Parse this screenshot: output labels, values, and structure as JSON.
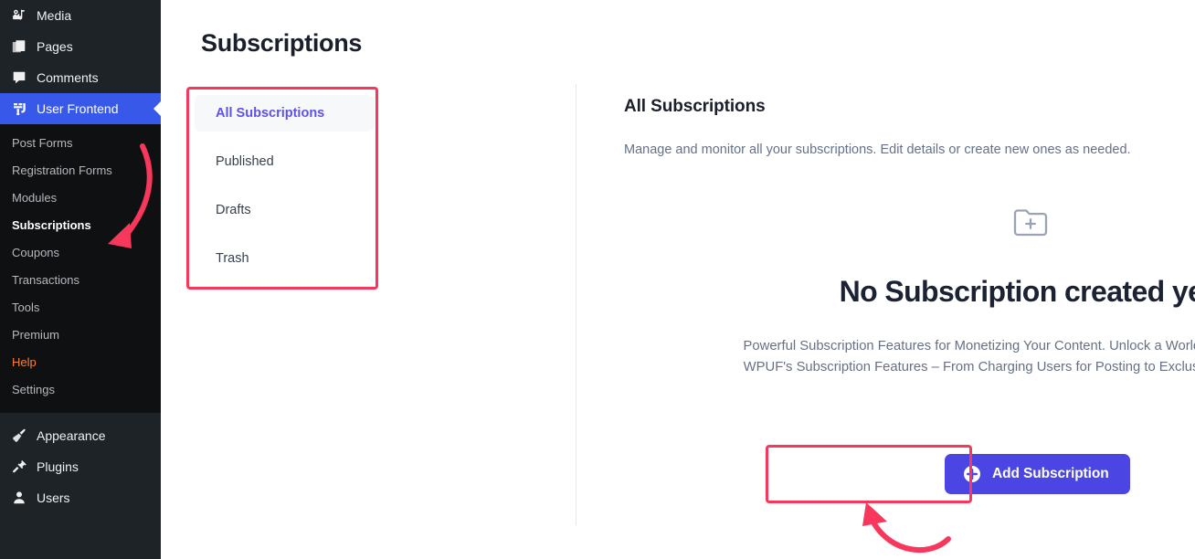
{
  "sidebar": {
    "top_items": [
      {
        "label": "Media",
        "icon": "media-icon"
      },
      {
        "label": "Pages",
        "icon": "pages-icon"
      },
      {
        "label": "Comments",
        "icon": "comments-icon"
      }
    ],
    "active_item": {
      "label": "User Frontend",
      "icon": "wpuf-logo-icon"
    },
    "submenu_items": [
      {
        "label": "Post Forms",
        "state": "normal"
      },
      {
        "label": "Registration Forms",
        "state": "normal"
      },
      {
        "label": "Modules",
        "state": "normal"
      },
      {
        "label": "Subscriptions",
        "state": "current"
      },
      {
        "label": "Coupons",
        "state": "normal"
      },
      {
        "label": "Transactions",
        "state": "normal"
      },
      {
        "label": "Tools",
        "state": "normal"
      },
      {
        "label": "Premium",
        "state": "normal"
      },
      {
        "label": "Help",
        "state": "help"
      },
      {
        "label": "Settings",
        "state": "normal"
      }
    ],
    "bottom_items": [
      {
        "label": "Appearance",
        "icon": "appearance-brush-icon"
      },
      {
        "label": "Plugins",
        "icon": "plugins-plug-icon"
      },
      {
        "label": "Users",
        "icon": "users-person-icon"
      }
    ]
  },
  "header": {
    "title": "Subscriptions"
  },
  "tabs": [
    {
      "label": "All Subscriptions",
      "selected": true
    },
    {
      "label": "Published",
      "selected": false
    },
    {
      "label": "Drafts",
      "selected": false
    },
    {
      "label": "Trash",
      "selected": false
    }
  ],
  "content": {
    "title": "All Subscriptions",
    "subtitle": "Manage and monitor all your subscriptions. Edit details or create new ones as needed."
  },
  "empty_state": {
    "icon": "folder-plus-icon",
    "heading": "No Subscription created yet!",
    "description": "Powerful Subscription Features for Monetizing Your Content. Unlock a World of Possibilities with WPUF's Subscription Features – From Charging Users for Posting to Exclusive Content Access."
  },
  "primary_button": {
    "label": "Add Subscription",
    "icon": "plus-circle-icon"
  },
  "colors": {
    "sidebar_bg": "#1d2327",
    "submenu_bg": "#0f1011",
    "active_menu_bg": "#3858e9",
    "accent_purple": "#5c52e8",
    "button_bg": "#4b46e3",
    "annotation_red": "#f8375c",
    "help_orange": "#f5803e",
    "heading_dark": "#1b2233",
    "body_gray": "#667085"
  }
}
